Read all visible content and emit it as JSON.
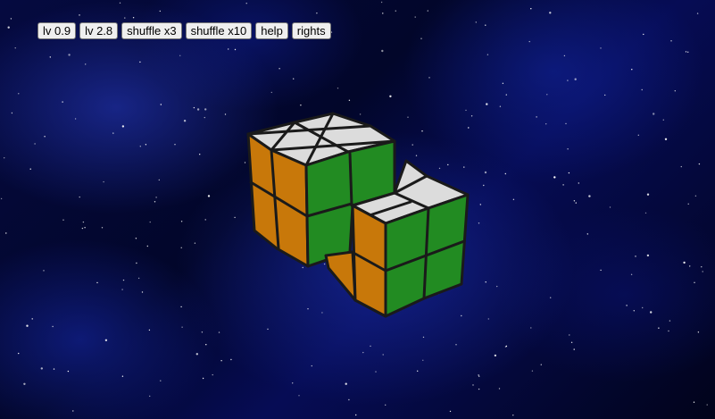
{
  "toolbar": {
    "buttons": [
      {
        "id": "lv-0-9",
        "label": "lv 0.9"
      },
      {
        "id": "lv-2-8",
        "label": "lv 2.8"
      },
      {
        "id": "shuffle-x3",
        "label": "shuffle x3"
      },
      {
        "id": "shuffle-x10",
        "label": "shuffle x10"
      },
      {
        "id": "help",
        "label": "help"
      },
      {
        "id": "rights",
        "label": "rights"
      }
    ]
  },
  "puzzle": {
    "face_colors": {
      "top": "#dcdcdc",
      "left": "#c8780a",
      "right": "#228b22",
      "edge": "#1a1a1a"
    }
  }
}
